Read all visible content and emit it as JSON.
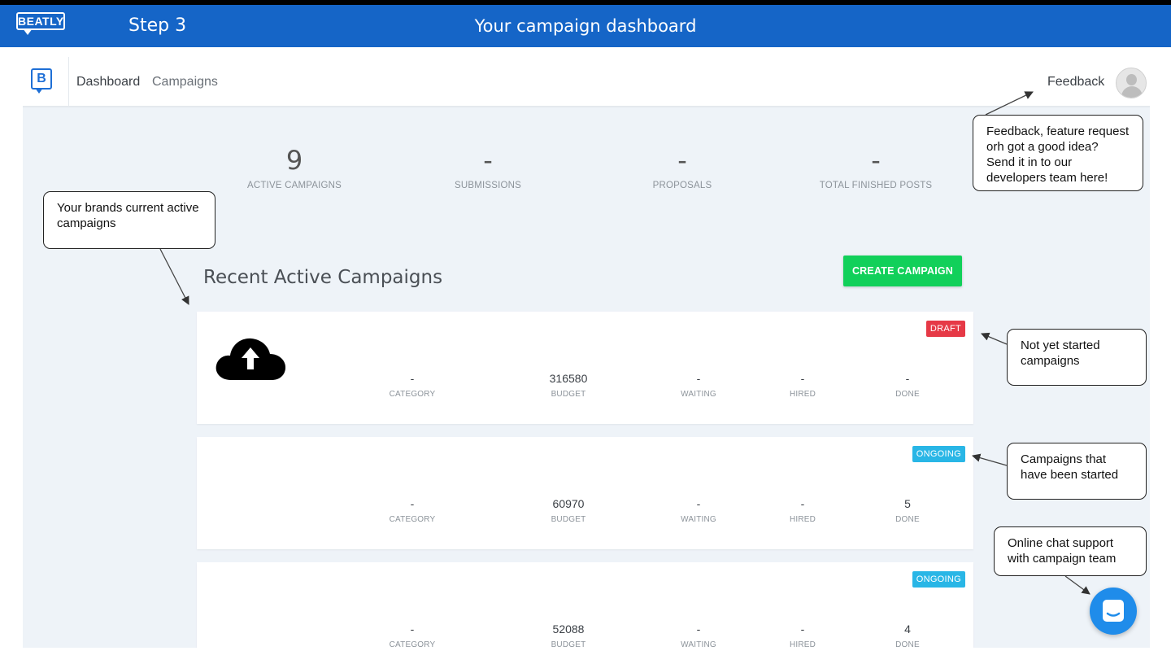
{
  "banner": {
    "logo_text": "BEATLY",
    "step": "Step 3",
    "title": "Your campaign dashboard"
  },
  "nav": {
    "brand_letter": "B",
    "links": [
      "Dashboard",
      "Campaigns"
    ],
    "feedback": "Feedback"
  },
  "stats": [
    {
      "value": "9",
      "label": "ACTIVE CAMPAIGNS"
    },
    {
      "value": "-",
      "label": "SUBMISSIONS"
    },
    {
      "value": "-",
      "label": "PROPOSALS"
    },
    {
      "value": "-",
      "label": "TOTAL FINISHED POSTS"
    }
  ],
  "section_title": "Recent Active Campaigns",
  "create_button": "CREATE CAMPAIGN",
  "column_labels": [
    "CATEGORY",
    "BUDGET",
    "WAITING",
    "HIRED",
    "DONE"
  ],
  "campaigns": [
    {
      "status": "DRAFT",
      "values": [
        "-",
        "316580",
        "-",
        "-",
        "-"
      ]
    },
    {
      "status": "ONGOING",
      "values": [
        "-",
        "60970",
        "-",
        "-",
        "5"
      ]
    },
    {
      "status": "ONGOING",
      "values": [
        "-",
        "52088",
        "-",
        "-",
        "4"
      ]
    }
  ],
  "annotations": {
    "feedback": "Feedback, feature request orh got a good idea? Send it in to our developers team here!",
    "active": "Your brands current active campaigns",
    "draft": "Not yet started campaigns",
    "started": "Campaigns that have been started",
    "chat": "Online chat support with campaign team"
  },
  "colors": {
    "banner": "#1565c7",
    "brand": "#1e6fd6",
    "create": "#11d05a",
    "draft": "#e63946",
    "ongoing": "#29b6e6",
    "chat": "#1f8cea"
  },
  "icons": {
    "upload": "cloud-upload-icon",
    "chat": "chat-icon",
    "avatar": "user-avatar-icon"
  }
}
